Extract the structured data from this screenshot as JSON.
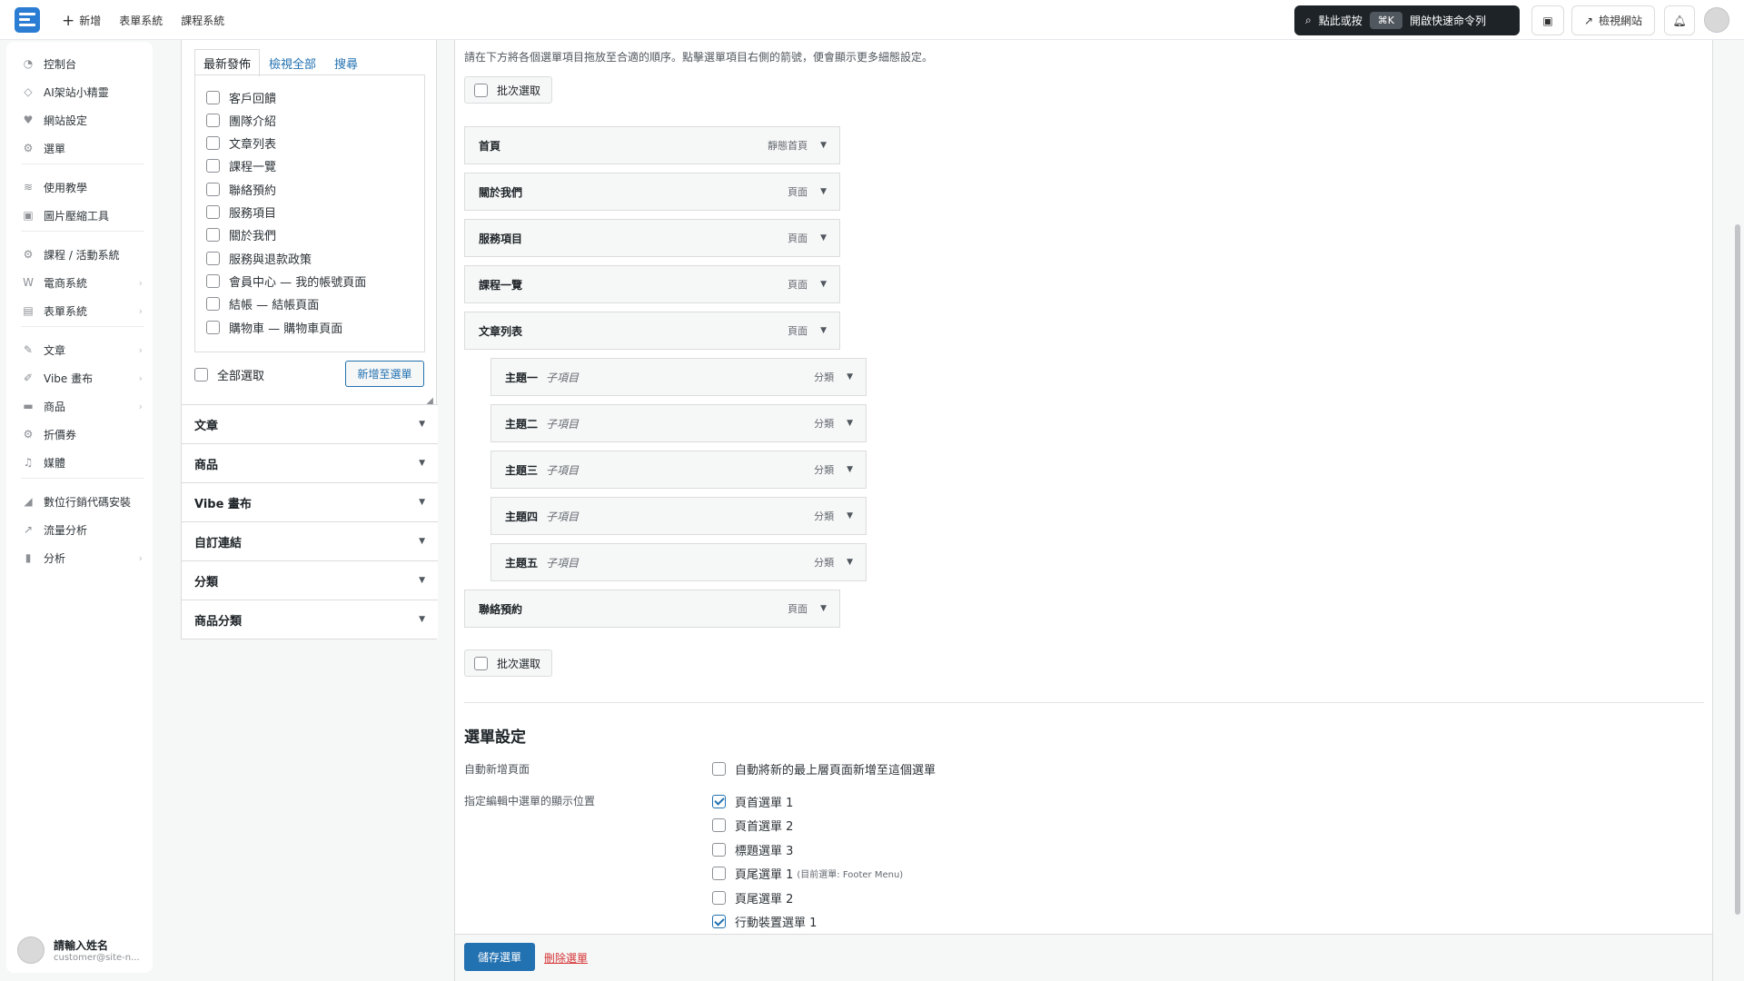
{
  "topbar": {
    "nav": [
      "新增",
      "表單系統",
      "課程系統"
    ],
    "command": {
      "label": "點此或按",
      "kbd": "⌘K",
      "action": "開啟快速命令列"
    },
    "view_site": "檢視網站"
  },
  "sidebar": {
    "items": [
      {
        "label": "控制台",
        "icon": "gauge-icon",
        "glyph": "◔",
        "chevron": false
      },
      {
        "label": "AI架站小精靈",
        "icon": "sparkle-icon",
        "glyph": "◇",
        "chevron": false
      },
      {
        "label": "網站設定",
        "icon": "heart-icon",
        "glyph": "♥",
        "chevron": false
      },
      {
        "label": "選單",
        "icon": "gear-icon",
        "glyph": "⚙",
        "chevron": false
      },
      {
        "label": "使用教學",
        "icon": "graduation-cap-icon",
        "glyph": "≋",
        "chevron": false
      },
      {
        "label": "圖片壓縮工具",
        "icon": "image-icon",
        "glyph": "▣",
        "chevron": false
      },
      {
        "label": "課程 / 活動系統",
        "icon": "gear-icon",
        "glyph": "⚙",
        "chevron": false
      },
      {
        "label": "電商系統",
        "icon": "woo-icon",
        "glyph": "W",
        "chevron": true
      },
      {
        "label": "表單系統",
        "icon": "form-icon",
        "glyph": "▤",
        "chevron": true
      },
      {
        "label": "文章",
        "icon": "pin-icon",
        "glyph": "✎",
        "chevron": true
      },
      {
        "label": "Vibe 畫布",
        "icon": "brush-icon",
        "glyph": "✐",
        "chevron": true
      },
      {
        "label": "商品",
        "icon": "box-icon",
        "glyph": "▬",
        "chevron": true
      },
      {
        "label": "折價券",
        "icon": "gear-icon",
        "glyph": "⚙",
        "chevron": false
      },
      {
        "label": "媒體",
        "icon": "media-icon",
        "glyph": "♫",
        "chevron": false
      },
      {
        "label": "數位行銷代碼安裝",
        "icon": "chart-icon",
        "glyph": "◢",
        "chevron": false
      },
      {
        "label": "流量分析",
        "icon": "trend-icon",
        "glyph": "↗",
        "chevron": false
      },
      {
        "label": "分析",
        "icon": "bar-chart-icon",
        "glyph": "▮",
        "chevron": true
      }
    ],
    "user": {
      "name": "請輸入姓名",
      "email": "customer@site-n..."
    }
  },
  "panel": {
    "tabs": [
      "最新發佈",
      "檢視全部",
      "搜尋"
    ],
    "pages": [
      "客戶回饋",
      "團隊介紹",
      "文章列表",
      "課程一覽",
      "聯絡預約",
      "服務項目",
      "關於我們",
      "服務與退款政策",
      "會員中心 — 我的帳號頁面",
      "結帳 — 結帳頁面",
      "購物車 — 購物車頁面"
    ],
    "select_all": "全部選取",
    "add_button": "新增至選單",
    "accordions": [
      "文章",
      "商品",
      "Vibe 畫布",
      "自訂連結",
      "分類",
      "商品分類"
    ]
  },
  "menu": {
    "instructions": "請在下方將各個選單項目拖放至合適的順序。點擊選單項目右側的箭號，便會顯示更多細態設定。",
    "bulk_select": "批次選取",
    "items": [
      {
        "title": "首頁",
        "sub": "",
        "type": "靜態首頁",
        "depth": 0
      },
      {
        "title": "關於我們",
        "sub": "",
        "type": "頁面",
        "depth": 0
      },
      {
        "title": "服務項目",
        "sub": "",
        "type": "頁面",
        "depth": 0
      },
      {
        "title": "課程一覽",
        "sub": "",
        "type": "頁面",
        "depth": 0
      },
      {
        "title": "文章列表",
        "sub": "",
        "type": "頁面",
        "depth": 0
      },
      {
        "title": "主題一",
        "sub": "子項目",
        "type": "分類",
        "depth": 1
      },
      {
        "title": "主題二",
        "sub": "子項目",
        "type": "分類",
        "depth": 1
      },
      {
        "title": "主題三",
        "sub": "子項目",
        "type": "分類",
        "depth": 1
      },
      {
        "title": "主題四",
        "sub": "子項目",
        "type": "分類",
        "depth": 1
      },
      {
        "title": "主題五",
        "sub": "子項目",
        "type": "分類",
        "depth": 1
      },
      {
        "title": "聯絡預約",
        "sub": "",
        "type": "頁面",
        "depth": 0
      }
    ]
  },
  "settings": {
    "heading": "選單設定",
    "auto_add_label": "自動新增頁面",
    "auto_add_option": "自動將新的最上層頁面新增至這個選單",
    "locations_label": "指定編輯中選單的顯示位置",
    "locations": [
      {
        "label": "頁首選單 1",
        "note": "",
        "checked": true
      },
      {
        "label": "頁首選單 2",
        "note": "",
        "checked": false
      },
      {
        "label": "標題選單 3",
        "note": "",
        "checked": false
      },
      {
        "label": "頁尾選單 1",
        "note": "(目前選單: Footer Menu)",
        "checked": false
      },
      {
        "label": "頁尾選單 2",
        "note": "",
        "checked": false
      },
      {
        "label": "行動裝置選單 1",
        "note": "",
        "checked": true
      }
    ]
  },
  "footer": {
    "save": "儲存選單",
    "delete": "刪除選單"
  }
}
